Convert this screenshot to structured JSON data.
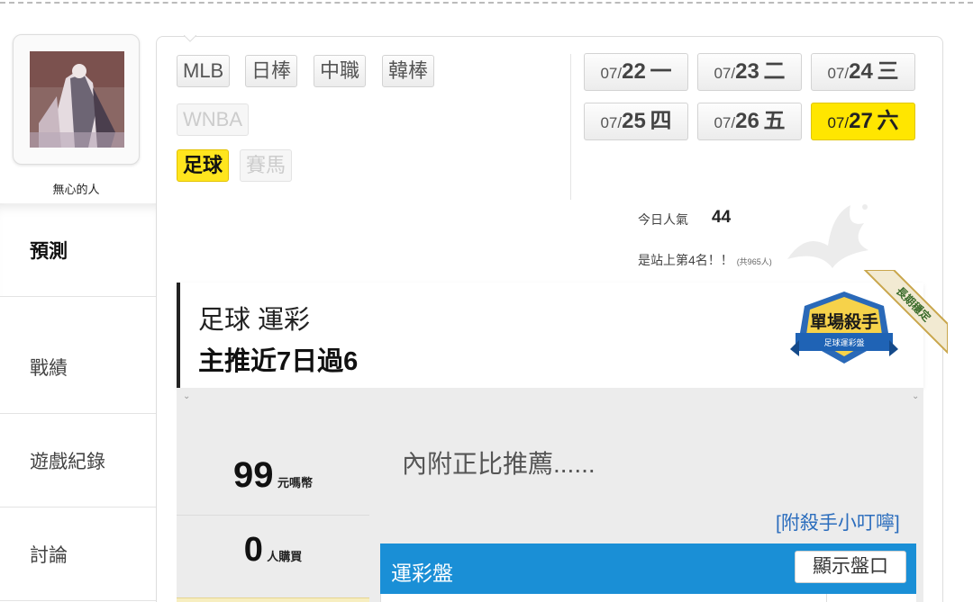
{
  "profile": {
    "username": "無心的人"
  },
  "side_nav": [
    {
      "label": "預測",
      "active": true
    },
    {
      "label": "戰績",
      "active": false
    },
    {
      "label": "遊戲紀錄",
      "active": false
    },
    {
      "label": "討論",
      "active": false
    }
  ],
  "sport_tabs": [
    {
      "label": "MLB",
      "state": "normal"
    },
    {
      "label": "日棒",
      "state": "normal"
    },
    {
      "label": "中職",
      "state": "normal"
    },
    {
      "label": "韓棒",
      "state": "normal"
    },
    {
      "label": "WNBA",
      "state": "disabled"
    },
    {
      "label": "足球",
      "state": "active"
    },
    {
      "label": "賽馬",
      "state": "disabled"
    }
  ],
  "dates": [
    {
      "prefix": "07/",
      "day": "22",
      "weekday": "一",
      "active": false
    },
    {
      "prefix": "07/",
      "day": "23",
      "weekday": "二",
      "active": false
    },
    {
      "prefix": "07/",
      "day": "24",
      "weekday": "三",
      "active": false
    },
    {
      "prefix": "07/",
      "day": "25",
      "weekday": "四",
      "active": false
    },
    {
      "prefix": "07/",
      "day": "26",
      "weekday": "五",
      "active": false
    },
    {
      "prefix": "07/",
      "day": "27",
      "weekday": "六",
      "active": true
    }
  ],
  "popularity": {
    "label": "今日人氣",
    "value": "44",
    "rank_text": "是站上第4名！！",
    "rank_total": "(共965人)"
  },
  "headline": {
    "line1": "足球 運彩",
    "line2": "主推近7日過6"
  },
  "badge": {
    "title": "單場殺手",
    "subtitle": "足球運彩盤",
    "ribbon": "長期穩定"
  },
  "price": {
    "coins": "99",
    "coins_unit": "元嗎幣",
    "buyers": "0",
    "buyers_unit": "人購買"
  },
  "teaser": "內附正比推薦......",
  "tips_link": "[附殺手小叮嚀]",
  "odds": {
    "title": "運彩盤",
    "show_button": "顯示盤口"
  },
  "colors": {
    "active_yellow": "#ffe600",
    "odds_blue": "#1a8fd6",
    "link_blue": "#2b6dbd"
  }
}
